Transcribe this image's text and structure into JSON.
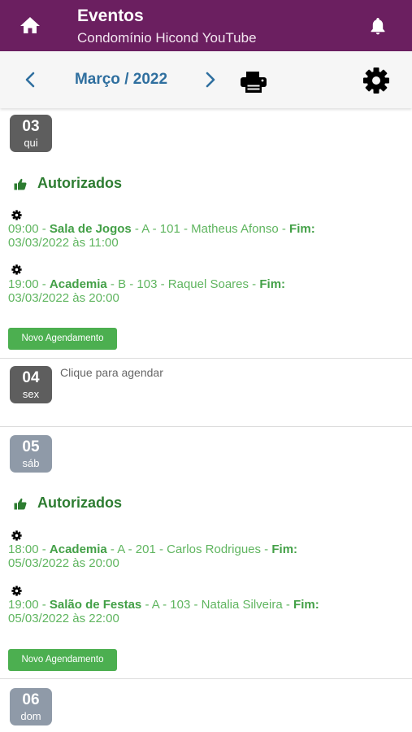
{
  "header": {
    "title": "Eventos",
    "subtitle": "Condomínio Hicond YouTube"
  },
  "toolbar": {
    "month_label": "Março / 2022"
  },
  "days": [
    {
      "num": "03",
      "weekday": "qui",
      "group_label": "Autorizados",
      "events": [
        {
          "time": "09:00",
          "sep1": " - ",
          "place": "Sala de Jogos",
          "details": " - A - 101 - Matheus Afonso - ",
          "fim_label": "Fim:",
          "end": "03/03/2022 às 11:00"
        },
        {
          "time": "19:00",
          "sep1": " - ",
          "place": "Academia",
          "details": " - B - 103 - Raquel Soares - ",
          "fim_label": "Fim:",
          "end": "03/03/2022 às 20:00"
        }
      ],
      "new_button": "Novo Agendamento"
    },
    {
      "num": "04",
      "weekday": "sex",
      "hint": "Clique para agendar"
    },
    {
      "num": "05",
      "weekday": "sáb",
      "group_label": "Autorizados",
      "events": [
        {
          "time": "18:00",
          "sep1": " - ",
          "place": "Academia",
          "details": " - A - 201 - Carlos Rodrigues - ",
          "fim_label": "Fim:",
          "end": "05/03/2022 às 20:00"
        },
        {
          "time": "19:00",
          "sep1": " - ",
          "place": "Salão de Festas",
          "details": " - A - 103 - Natalia Silveira - ",
          "fim_label": "Fim:",
          "end": "05/03/2022 às 22:00"
        }
      ],
      "new_button": "Novo Agendamento"
    },
    {
      "num": "06",
      "weekday": "dom"
    }
  ]
}
